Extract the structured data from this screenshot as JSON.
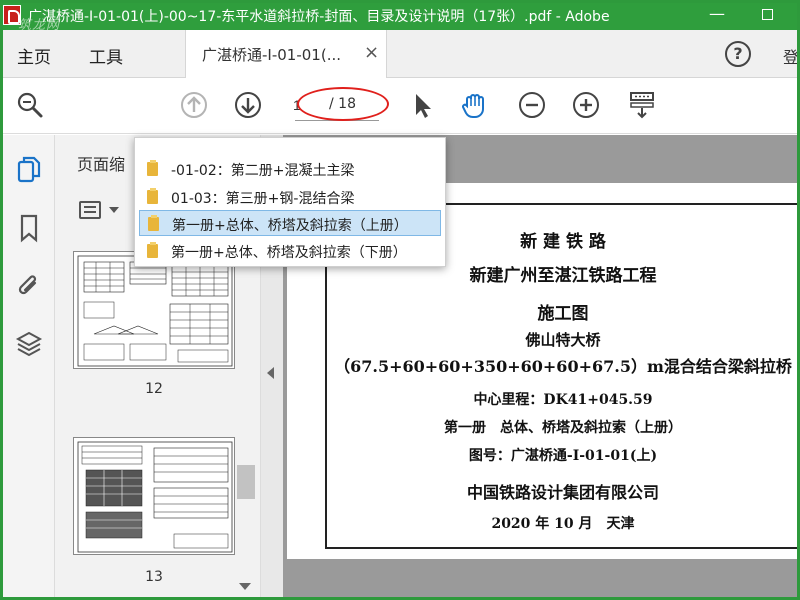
{
  "window": {
    "title": "广湛桥通-Ⅰ-01-01(上)-00~17-东平水道斜拉桥-封面、目录及设计说明（17张）.pdf - Adobe",
    "watermark": "筑龙网",
    "minimize_glyph": "—"
  },
  "menubar": {
    "home": "主页",
    "tools": "工具",
    "tab_label": "广湛桥通-Ⅰ-01-01(...",
    "tab_close": "×",
    "help": "?",
    "login": "登"
  },
  "toolbar": {
    "current_page": "1",
    "total_pages": "/ 18"
  },
  "thumbnails": {
    "title": "页面缩",
    "pages": [
      {
        "number": "12"
      },
      {
        "number": "13"
      }
    ]
  },
  "dropdown": {
    "items": [
      {
        "label": "-01-02：第二册+混凝土主梁",
        "selected": false
      },
      {
        "label": "01-03：第三册+钢-混结合梁",
        "selected": false
      },
      {
        "label": "第一册+总体、桥塔及斜拉索（上册）",
        "selected": true
      },
      {
        "label": "第一册+总体、桥塔及斜拉索（下册）",
        "selected": false
      }
    ]
  },
  "document": {
    "line1": "新 建 铁 路",
    "line2": "新建广州至湛江铁路工程",
    "line3": "施工图",
    "line4": "佛山特大桥",
    "line5": "（67.5+60+60+350+60+60+67.5）m混合结合梁斜拉桥",
    "line6": "中心里程：DK41+045.59",
    "line7": "第一册　总体、桥塔及斜拉索（上册）",
    "line8": "图号：广湛桥通-Ⅰ-01-01(上)",
    "line9": "中国铁路设计集团有限公司",
    "line10": "2020 年 10 月　天津"
  },
  "colors": {
    "frame_green": "#2f9e3d",
    "accent_blue": "#1a73c8",
    "annotation_red": "#e0201c",
    "selection": "#cce4f7"
  }
}
